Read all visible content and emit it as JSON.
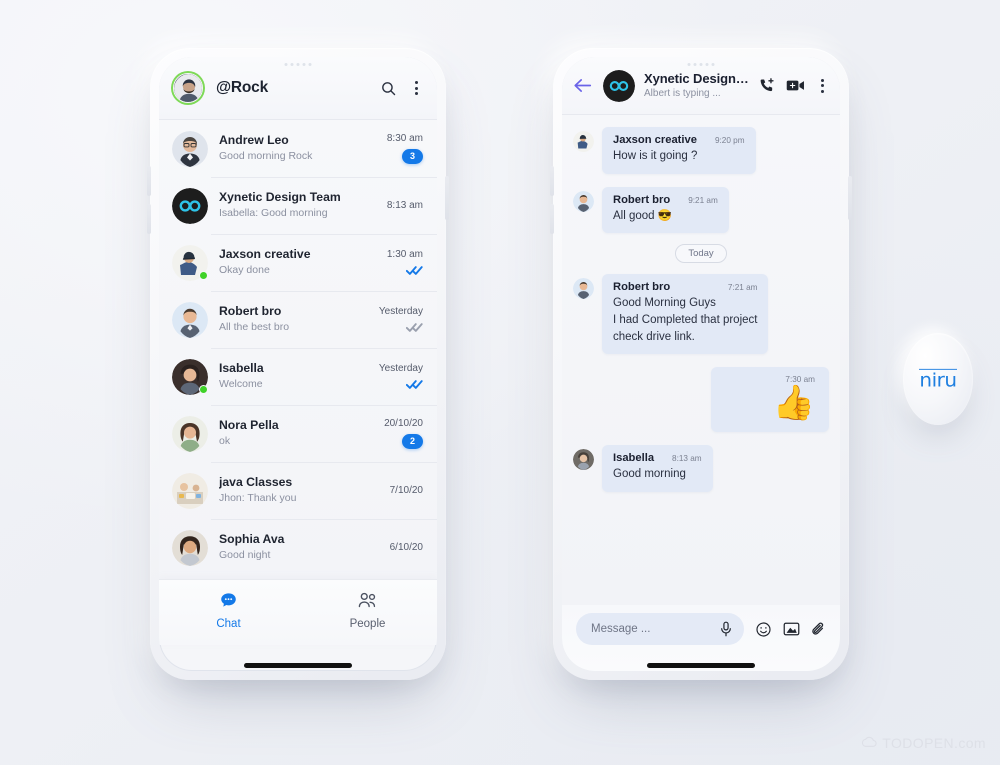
{
  "colors": {
    "accent": "#1479e8",
    "bubble": "#e2e9f6",
    "online": "#3fd228",
    "background": "#eef0f5",
    "back_arrow": "#6a63e8",
    "logo_blue": "#1f7fe0"
  },
  "left_phone": {
    "appbar": {
      "avatar_name": "user-avatar",
      "title": "@Rock",
      "search_icon": "search-icon",
      "more_icon": "overflow-menu-icon"
    },
    "chats": [
      {
        "name": "Andrew Leo",
        "preview": "Good morning Rock",
        "time": "8:30 am",
        "badge": "3",
        "status": "",
        "online": false
      },
      {
        "name": "Xynetic Design Team",
        "preview": "Isabella: Good morning",
        "time": "8:13 am",
        "badge": "",
        "status": "",
        "online": false
      },
      {
        "name": "Jaxson creative",
        "preview": "Okay done",
        "time": "1:30 am",
        "badge": "",
        "status": "read",
        "online": true
      },
      {
        "name": "Robert bro",
        "preview": "All the best bro",
        "time": "Yesterday",
        "badge": "",
        "status": "delivered",
        "online": false
      },
      {
        "name": "Isabella",
        "preview": "Welcome",
        "time": "Yesterday",
        "badge": "",
        "status": "read",
        "online": true
      },
      {
        "name": "Nora Pella",
        "preview": "ok",
        "time": "20/10/20",
        "badge": "2",
        "status": "",
        "online": false
      },
      {
        "name": "java Classes",
        "preview": "Jhon: Thank you",
        "time": "7/10/20",
        "badge": "",
        "status": "",
        "online": false
      },
      {
        "name": "Sophia Ava",
        "preview": "Good night",
        "time": "6/10/20",
        "badge": "",
        "status": "",
        "online": false
      }
    ],
    "bottom_nav": [
      {
        "label": "Chat",
        "icon": "chat-bubble-icon",
        "active": true
      },
      {
        "label": "People",
        "icon": "people-icon",
        "active": false
      }
    ]
  },
  "right_phone": {
    "conv_bar": {
      "back_icon": "back-arrow-icon",
      "title": "Xynetic Design ...",
      "subtitle": "Albert  is typing ...",
      "add_call_icon": "add-call-icon",
      "video_call_icon": "video-call-icon",
      "more_icon": "overflow-menu-icon"
    },
    "messages": [
      {
        "kind": "text",
        "side": "in",
        "name": "Jaxson creative",
        "time": "9:20 pm",
        "text": "How is it going ?"
      },
      {
        "kind": "text",
        "side": "in",
        "name": "Robert bro",
        "time": "9:21 am",
        "text": "All good 😎"
      },
      {
        "kind": "separator",
        "label": "Today"
      },
      {
        "kind": "text",
        "side": "in",
        "name": "Robert bro",
        "time": "7:21 am",
        "text": "Good Morning Guys\nI had Completed that project\ncheck drive link."
      },
      {
        "kind": "sticker",
        "side": "out",
        "time": "7:30 am",
        "glyph": "👍"
      },
      {
        "kind": "text",
        "side": "in",
        "name": "Isabella",
        "time": "8:13 am",
        "text": "Good morning"
      }
    ],
    "composer": {
      "placeholder": "Message ...",
      "mic_icon": "microphone-icon",
      "emoji_icon": "emoji-icon",
      "image_icon": "image-icon",
      "attach_icon": "attachment-icon"
    }
  },
  "logo_badge": {
    "text": "niru"
  },
  "watermark": {
    "text": "TODOPEN.com"
  }
}
